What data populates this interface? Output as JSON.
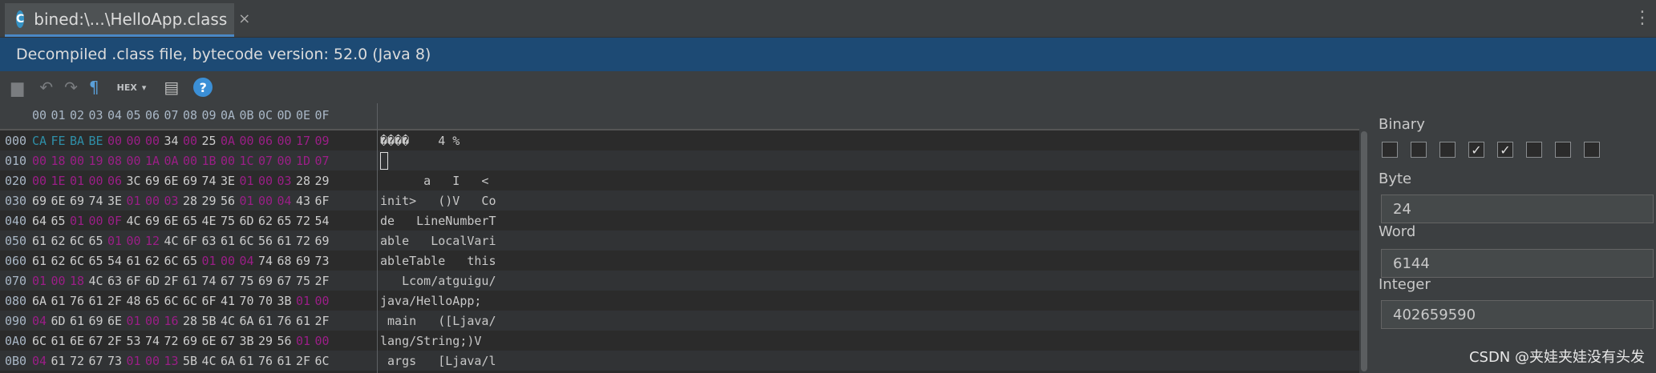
{
  "tab": {
    "title": "bined:\\...\\HelloApp.class",
    "close": "×",
    "icon_letter": "C"
  },
  "banner": {
    "text": "Decompiled .class file, bytecode version: 52.0 (Java 8)"
  },
  "toolbar": {
    "hex_mode": "HEX",
    "help": "?"
  },
  "hex": {
    "columns": [
      "00",
      "01",
      "02",
      "03",
      "04",
      "05",
      "06",
      "07",
      "08",
      "09",
      "0A",
      "0B",
      "0C",
      "0D",
      "0E",
      "0F"
    ],
    "rows": [
      {
        "addr": "000",
        "bytes": [
          "CA",
          "FE",
          "BA",
          "BE",
          "00",
          "00",
          "00",
          "34",
          "00",
          "25",
          "0A",
          "00",
          "06",
          "00",
          "17",
          "09"
        ],
        "ascii": "����    4 %"
      },
      {
        "addr": "010",
        "bytes": [
          "00",
          "18",
          "00",
          "19",
          "08",
          "00",
          "1A",
          "0A",
          "00",
          "1B",
          "00",
          "1C",
          "07",
          "00",
          "1D",
          "07"
        ],
        "ascii": ""
      },
      {
        "addr": "020",
        "bytes": [
          "00",
          "1E",
          "01",
          "00",
          "06",
          "3C",
          "69",
          "6E",
          "69",
          "74",
          "3E",
          "01",
          "00",
          "03",
          "28",
          "29"
        ],
        "ascii": "      a   I   <"
      },
      {
        "addr": "030",
        "bytes": [
          "69",
          "6E",
          "69",
          "74",
          "3E",
          "01",
          "00",
          "03",
          "28",
          "29",
          "56",
          "01",
          "00",
          "04",
          "43",
          "6F"
        ],
        "ascii": "init>   ()V   Co"
      },
      {
        "addr": "040",
        "bytes": [
          "64",
          "65",
          "01",
          "00",
          "0F",
          "4C",
          "69",
          "6E",
          "65",
          "4E",
          "75",
          "6D",
          "62",
          "65",
          "72",
          "54"
        ],
        "ascii": "de   LineNumberT"
      },
      {
        "addr": "050",
        "bytes": [
          "61",
          "62",
          "6C",
          "65",
          "01",
          "00",
          "12",
          "4C",
          "6F",
          "63",
          "61",
          "6C",
          "56",
          "61",
          "72",
          "69"
        ],
        "ascii": "able   LocalVari"
      },
      {
        "addr": "060",
        "bytes": [
          "61",
          "62",
          "6C",
          "65",
          "54",
          "61",
          "62",
          "6C",
          "65",
          "01",
          "00",
          "04",
          "74",
          "68",
          "69",
          "73"
        ],
        "ascii": "ableTable   this"
      },
      {
        "addr": "070",
        "bytes": [
          "01",
          "00",
          "18",
          "4C",
          "63",
          "6F",
          "6D",
          "2F",
          "61",
          "74",
          "67",
          "75",
          "69",
          "67",
          "75",
          "2F"
        ],
        "ascii": "   Lcom/atguigu/"
      },
      {
        "addr": "080",
        "bytes": [
          "6A",
          "61",
          "76",
          "61",
          "2F",
          "48",
          "65",
          "6C",
          "6C",
          "6F",
          "41",
          "70",
          "70",
          "3B",
          "01",
          "00"
        ],
        "ascii": "java/HelloApp;"
      },
      {
        "addr": "090",
        "bytes": [
          "04",
          "6D",
          "61",
          "69",
          "6E",
          "01",
          "00",
          "16",
          "28",
          "5B",
          "4C",
          "6A",
          "61",
          "76",
          "61",
          "2F"
        ],
        "ascii": " main   ([Ljava/"
      },
      {
        "addr": "0A0",
        "bytes": [
          "6C",
          "61",
          "6E",
          "67",
          "2F",
          "53",
          "74",
          "72",
          "69",
          "6E",
          "67",
          "3B",
          "29",
          "56",
          "01",
          "00"
        ],
        "ascii": "lang/String;)V"
      },
      {
        "addr": "0B0",
        "bytes": [
          "04",
          "61",
          "72",
          "67",
          "73",
          "01",
          "00",
          "13",
          "5B",
          "4C",
          "6A",
          "61",
          "76",
          "61",
          "2F",
          "6C"
        ],
        "ascii": " args   [Ljava/l"
      }
    ]
  },
  "inspector": {
    "binary_label": "Binary",
    "binary_bits": [
      false,
      false,
      false,
      true,
      true,
      false,
      false,
      false
    ],
    "byte_label": "Byte",
    "byte_value": "24",
    "word_label": "Word",
    "word_value": "6144",
    "integer_label": "Integer",
    "integer_value": "402659590"
  },
  "watermark": "CSDN @夹娃夹娃没有头发",
  "colors": {
    "banner": "#1d4a74",
    "magic": "#2f8fa8",
    "control_byte": "#9b1e87"
  }
}
